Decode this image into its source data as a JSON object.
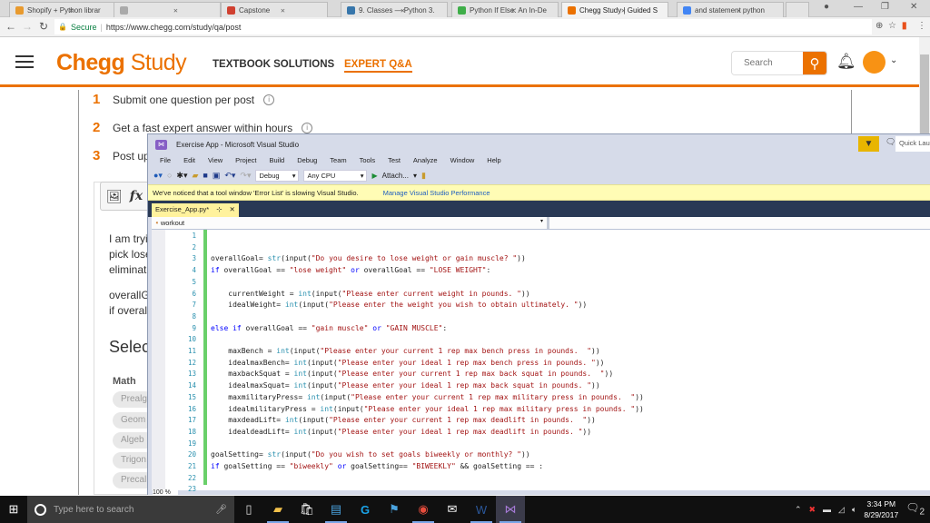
{
  "browser": {
    "tabs": [
      {
        "title": "Shopify + Python librar",
        "icon": "shopify-icon",
        "color": "#e89a2e",
        "active": false
      },
      {
        "title": "",
        "icon": "page-icon",
        "color": "#aaaaaa",
        "active": false
      },
      {
        "title": "Capstone",
        "icon": "page-icon",
        "color": "#d04030",
        "active": false
      },
      {
        "title": "9. Classes — Python 3.",
        "icon": "python-icon",
        "color": "#3776ab",
        "active": false
      },
      {
        "title": "Python If Else: An In-De",
        "icon": "upwork-icon",
        "color": "#3fae49",
        "active": false
      },
      {
        "title": "Chegg Study | Guided S",
        "icon": "chegg-icon",
        "color": "#eb7100",
        "active": true
      },
      {
        "title": "and statement python",
        "icon": "google-icon",
        "color": "#4285f4",
        "active": false
      }
    ],
    "address": {
      "secure_label": "Secure",
      "url": "https://www.chegg.com/study/qa/post"
    }
  },
  "chegg": {
    "logo_bold": "Chegg",
    "logo_light": "Study",
    "nav": [
      {
        "label": "TEXTBOOK SOLUTIONS",
        "active": false
      },
      {
        "label": "EXPERT Q&A",
        "active": true
      }
    ],
    "search_placeholder": "Search",
    "accent": "#eb7100",
    "steps": [
      {
        "num": "1",
        "text": "Submit one question per post"
      },
      {
        "num": "2",
        "text": "Get a fast expert answer within hours"
      },
      {
        "num": "3",
        "text": "Post up"
      }
    ],
    "question_lines": [
      "I am tryin",
      "pick lose",
      "eliminate",
      "overallG",
      "if overall"
    ],
    "select_heading": "Selec",
    "subject_heading": "Math",
    "subjects": [
      "Prealg",
      "Geom",
      "Algeb",
      "Trigon",
      "Precal"
    ]
  },
  "vs": {
    "title": "Exercise App - Microsoft Visual Studio",
    "quick_launch": "Quick Laun",
    "menu": [
      "File",
      "Edit",
      "View",
      "Project",
      "Build",
      "Debug",
      "Team",
      "Tools",
      "Test",
      "Analyze",
      "Window",
      "Help"
    ],
    "config": "Debug",
    "platform": "Any CPU",
    "attach": "Attach...",
    "info_message": "We've noticed that a tool window 'Error List' is slowing Visual Studio.",
    "info_link": "Manage Visual Studio Performance",
    "doc_tab": "Exercise_App.py*",
    "nav_scope": "workout",
    "zoom": "100 %",
    "code": [
      {
        "n": "1",
        "t": ""
      },
      {
        "n": "2",
        "t": ""
      },
      {
        "n": "3",
        "t": "overallGoal= str(input(\"Do you desire to lose weight or gain muscle? \"))"
      },
      {
        "n": "4",
        "t": "if overallGoal == \"lose weight\" or overallGoal == \"LOSE WEIGHT\":"
      },
      {
        "n": "5",
        "t": ""
      },
      {
        "n": "6",
        "t": "    currentWeight = int(input(\"Please enter current weight in pounds. \"))"
      },
      {
        "n": "7",
        "t": "    idealWeight= int(input(\"Please enter the weight you wish to obtain ultimately. \"))"
      },
      {
        "n": "8",
        "t": ""
      },
      {
        "n": "9",
        "t": "else if overallGoal == \"gain muscle\" or \"GAIN MUSCLE\":"
      },
      {
        "n": "10",
        "t": ""
      },
      {
        "n": "11",
        "t": "    maxBench = int(input(\"Please enter your current 1 rep max bench press in pounds.  \"))"
      },
      {
        "n": "12",
        "t": "    idealmaxBench= int(input(\"Please enter your ideal 1 rep max bench press in pounds. \"))"
      },
      {
        "n": "13",
        "t": "    maxbackSquat = int(input(\"Please enter your current 1 rep max back squat in pounds.  \"))"
      },
      {
        "n": "14",
        "t": "    idealmaxSquat= int(input(\"Please enter your ideal 1 rep max back squat in pounds. \"))"
      },
      {
        "n": "15",
        "t": "    maxmilitaryPress= int(input(\"Please enter your current 1 rep max military press in pounds.  \"))"
      },
      {
        "n": "16",
        "t": "    idealmilitaryPress = int(input(\"Please enter your ideal 1 rep max military press in pounds. \"))"
      },
      {
        "n": "17",
        "t": "    maxdeadLift= int(input(\"Please enter your current 1 rep max deadlift in pounds.  \"))"
      },
      {
        "n": "18",
        "t": "    idealdeadLift= int(input(\"Please enter your ideal 1 rep max deadlift in pounds. \"))"
      },
      {
        "n": "19",
        "t": ""
      },
      {
        "n": "20",
        "t": "goalSetting= str(input(\"Do you wish to set goals biweekly or monthly? \"))"
      },
      {
        "n": "21",
        "t": "if goalSetting == \"biweekly\" or goalSetting== \"BIWEEKLY\" && goalSetting == :"
      },
      {
        "n": "22",
        "t": ""
      },
      {
        "n": "23",
        "t": ""
      }
    ]
  },
  "taskbar": {
    "search_placeholder": "Type here to search",
    "apps": [
      "task-view-icon",
      "file-explorer-icon",
      "store-icon",
      "contacts-icon",
      "logitech-icon",
      "network-app-icon",
      "chrome-icon",
      "mail-icon",
      "word-icon",
      "visual-studio-icon"
    ],
    "time": "3:34 PM",
    "date": "8/29/2017",
    "notifications": "2"
  }
}
